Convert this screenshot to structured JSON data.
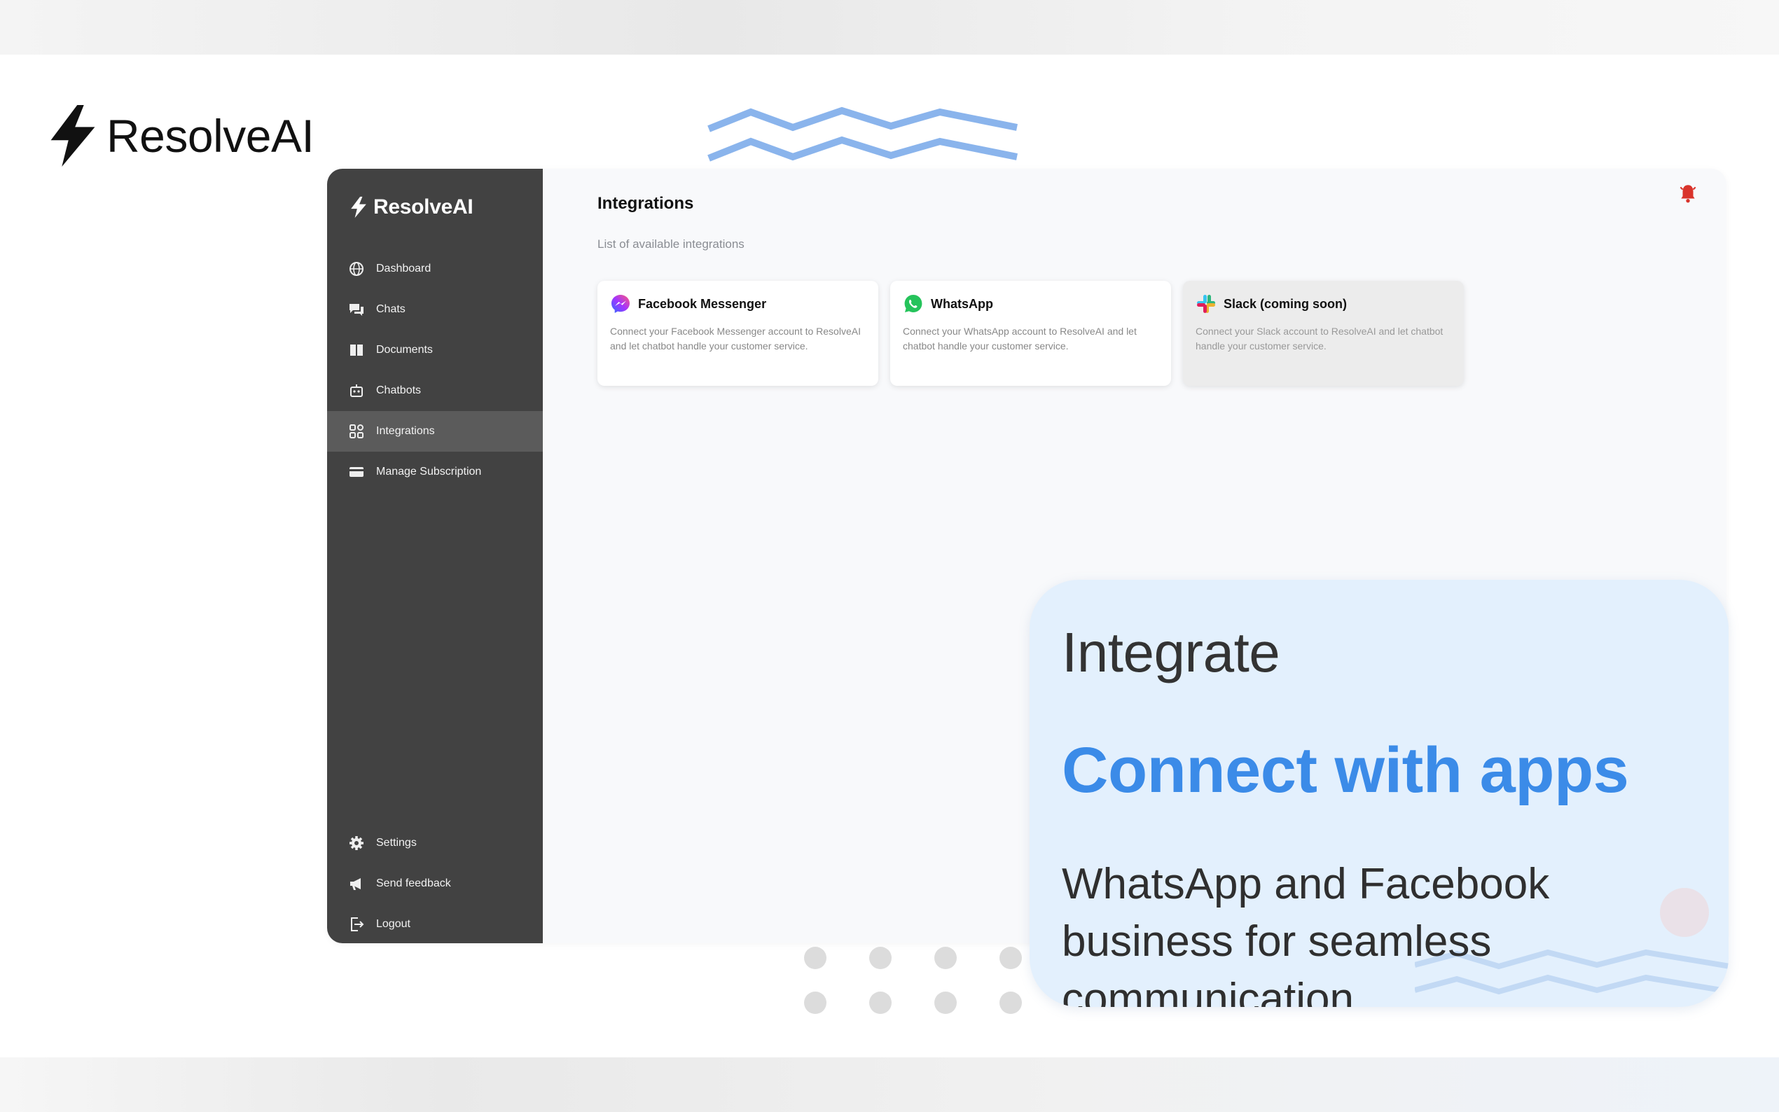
{
  "brand": {
    "name": "ResolveAI"
  },
  "sidebar": {
    "brand": "ResolveAI",
    "items": [
      {
        "label": "Dashboard",
        "icon": "globe-icon"
      },
      {
        "label": "Chats",
        "icon": "chat-bubbles-icon"
      },
      {
        "label": "Documents",
        "icon": "book-icon"
      },
      {
        "label": "Chatbots",
        "icon": "robot-icon"
      },
      {
        "label": "Integrations",
        "icon": "integrations-icon",
        "active": true
      },
      {
        "label": "Manage Subscription",
        "icon": "credit-card-icon"
      }
    ],
    "bottom_items": [
      {
        "label": "Settings",
        "icon": "gear-icon"
      },
      {
        "label": "Send feedback",
        "icon": "megaphone-icon"
      },
      {
        "label": "Logout",
        "icon": "logout-icon"
      }
    ]
  },
  "main": {
    "title": "Integrations",
    "subtitle": "List of available integrations",
    "cards": [
      {
        "title": "Facebook Messenger",
        "description": "Connect your Facebook Messenger account to ResolveAI and let chatbot handle your customer service.",
        "icon": "messenger-icon"
      },
      {
        "title": "WhatsApp",
        "description": "Connect your WhatsApp account to ResolveAI and let chatbot handle your customer service.",
        "icon": "whatsapp-icon"
      },
      {
        "title": "Slack (coming soon)",
        "description": "Connect your Slack account to ResolveAI and let chatbot handle your customer service.",
        "icon": "slack-icon",
        "disabled": true
      }
    ]
  },
  "promo": {
    "kicker": "Integrate",
    "title": "Connect with apps",
    "body": "WhatsApp and Facebook business for seamless communication"
  },
  "colors": {
    "accent": "#3b8be8",
    "sidebar": "#424242",
    "promo_bg": "#e3f0fd",
    "bell": "#d9342b"
  }
}
